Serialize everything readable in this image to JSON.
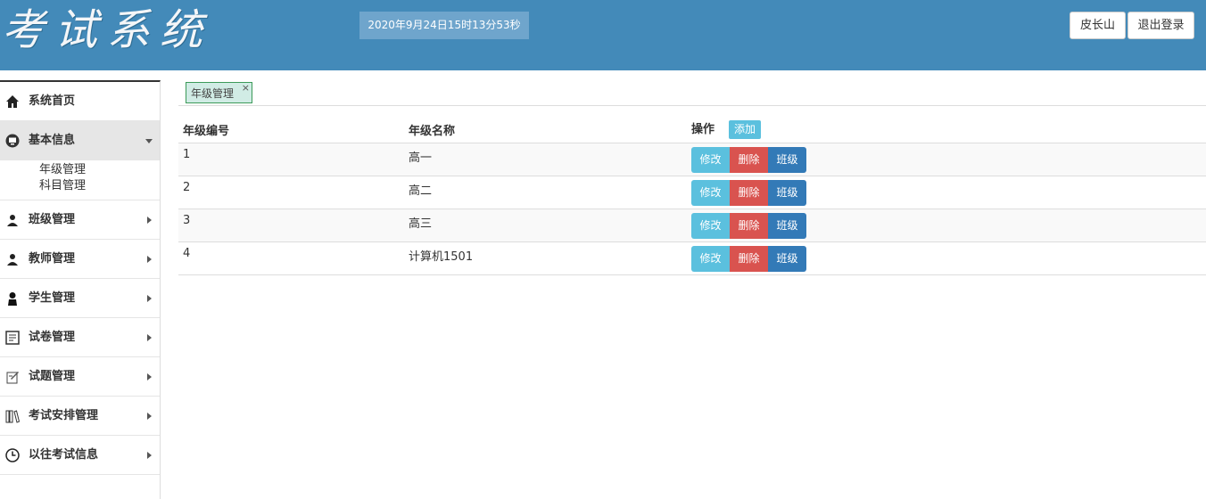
{
  "header": {
    "logo": "考试系统",
    "datetime": "2020年9月24日15时13分53秒",
    "user": "皮长山",
    "logout": "退出登录"
  },
  "sidebar": {
    "items": [
      {
        "label": "系统首页",
        "icon": "home-icon"
      },
      {
        "label": "基本信息",
        "icon": "monitor-icon"
      },
      {
        "label": "班级管理",
        "icon": "users-icon"
      },
      {
        "label": "教师管理",
        "icon": "users-icon"
      },
      {
        "label": "学生管理",
        "icon": "user-icon"
      },
      {
        "label": "试卷管理",
        "icon": "document-icon"
      },
      {
        "label": "试题管理",
        "icon": "edit-icon"
      },
      {
        "label": "考试安排管理",
        "icon": "books-icon"
      },
      {
        "label": "以往考试信息",
        "icon": "clock-icon"
      }
    ],
    "sub": [
      "年级管理",
      "科目管理"
    ]
  },
  "tab": {
    "label": "年级管理",
    "close": "×"
  },
  "table": {
    "headers": [
      "年级编号",
      "年级名称",
      "操作"
    ],
    "add": "添加",
    "actions": [
      "修改",
      "删除",
      "班级"
    ],
    "rows": [
      {
        "id": "1",
        "name": "高一"
      },
      {
        "id": "2",
        "name": "高二"
      },
      {
        "id": "3",
        "name": "高三"
      },
      {
        "id": "4",
        "name": "计算机1501"
      }
    ]
  },
  "colors": {
    "header": "#438ab9",
    "info": "#5bc0de",
    "danger": "#d9534f",
    "primary": "#337ab7"
  }
}
